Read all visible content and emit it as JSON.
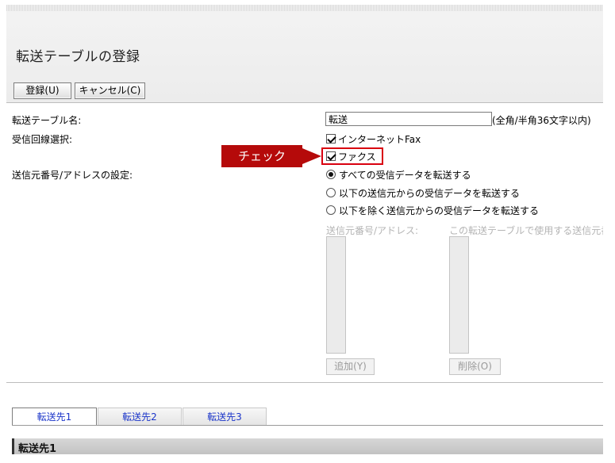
{
  "header": {
    "title": "転送テーブルの登録",
    "register_label": "登録(U)",
    "cancel_label": "キャンセル(C)"
  },
  "form": {
    "name_label": "転送テーブル名:",
    "name_value": "転送",
    "name_hint": "(全角/半角36文字以内)",
    "line_label": "受信回線選択:",
    "line_options": [
      "インターネットFax",
      "ファクス"
    ],
    "callout": "チェック",
    "sender_label": "送信元番号/アドレスの設定:",
    "radio_options": [
      "すべての受信データを転送する",
      "以下の送信元からの受信データを転送する",
      "以下を除く送信元からの受信データを転送する"
    ],
    "address_list_label": "送信元番号/アドレス:",
    "table_list_label": "この転送テーブルで使用する送信元番",
    "add_label": "追加(Y)",
    "delete_label": "削除(O)"
  },
  "tabs": [
    "転送先1",
    "転送先2",
    "転送先3"
  ],
  "section": {
    "title": "転送先1"
  },
  "colors": {
    "callout": "#b50a0a",
    "highlight_border": "#d9000f",
    "tab_text": "#1a34c9"
  }
}
